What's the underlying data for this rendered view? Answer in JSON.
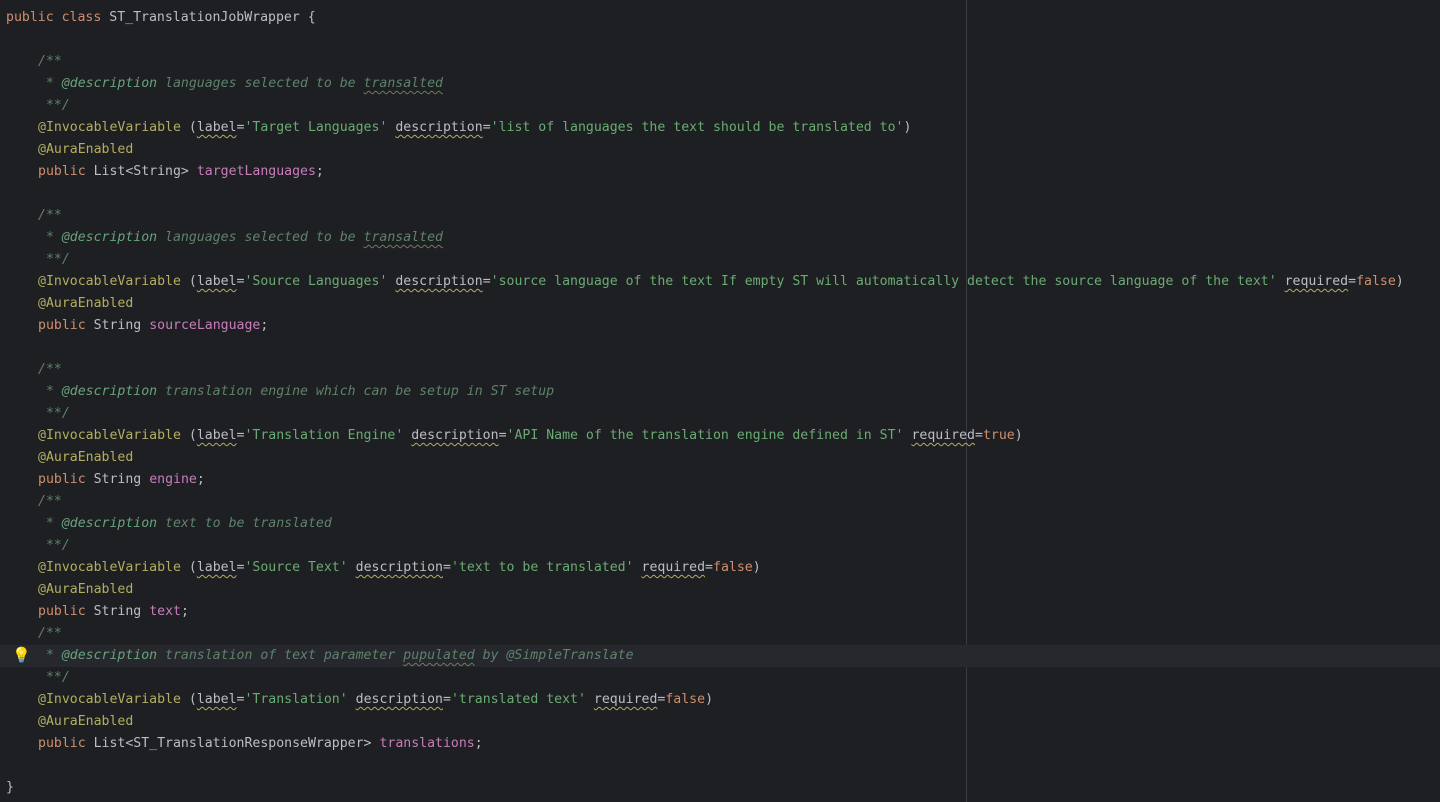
{
  "editor": {
    "class_decl": {
      "public": "public",
      "class": "class",
      "name": "ST_TranslationJobWrapper",
      "open": " {"
    },
    "close_brace": "}",
    "doc_open": "/**",
    "doc_close": " **/",
    "doc_star": " * ",
    "doc_tag": "@description",
    "annotation_name": "@InvocableVariable",
    "aura": "@AuraEnabled",
    "kw_public": "public",
    "kw_label": "label",
    "kw_description": "description",
    "kw_required": "required",
    "fields": [
      {
        "doc_text_before": " languages selected to be ",
        "doc_typo": "transalted",
        "doc_text_after": "",
        "label_value": "'Target Languages'",
        "description_value": "'list of languages the text should be translated to'",
        "required_value": "",
        "type": "List<String>",
        "name": "targetLanguages"
      },
      {
        "doc_text_before": " languages selected to be ",
        "doc_typo": "transalted",
        "doc_text_after": "",
        "label_value": "'Source Languages'",
        "description_value": "'source language of the text If empty ST will automatically detect the source language of the text'",
        "required_value": "false",
        "type": "String",
        "name": "sourceLanguage"
      },
      {
        "doc_text_before": " translation engine which can be setup in ST setup",
        "doc_typo": "",
        "doc_text_after": "",
        "label_value": "'Translation Engine'",
        "description_value": "'API Name of the translation engine defined in ST'",
        "required_value": "true",
        "type": "String",
        "name": "engine"
      },
      {
        "doc_text_before": " text to be translated",
        "doc_typo": "",
        "doc_text_after": "",
        "label_value": "'Source Text'",
        "description_value": "'text to be translated'",
        "required_value": "false",
        "type": "String",
        "name": "text"
      },
      {
        "doc_text_before": " translation of text parameter ",
        "doc_typo": "pupulated",
        "doc_text_after": " by @SimpleTranslate",
        "label_value": "'Translation'",
        "description_value": "'translated text'",
        "required_value": "false",
        "type": "List<ST_TranslationResponseWrapper>",
        "name": "translations"
      }
    ]
  },
  "icons": {
    "intention_bulb": "lightbulb-icon"
  },
  "colors": {
    "background": "#1e1f22",
    "keyword": "#cf8e6d",
    "field": "#c77dbb",
    "annotation": "#b3ae60",
    "string": "#6aab73",
    "doc_comment": "#5f826b",
    "default_text": "#bcbec4"
  }
}
